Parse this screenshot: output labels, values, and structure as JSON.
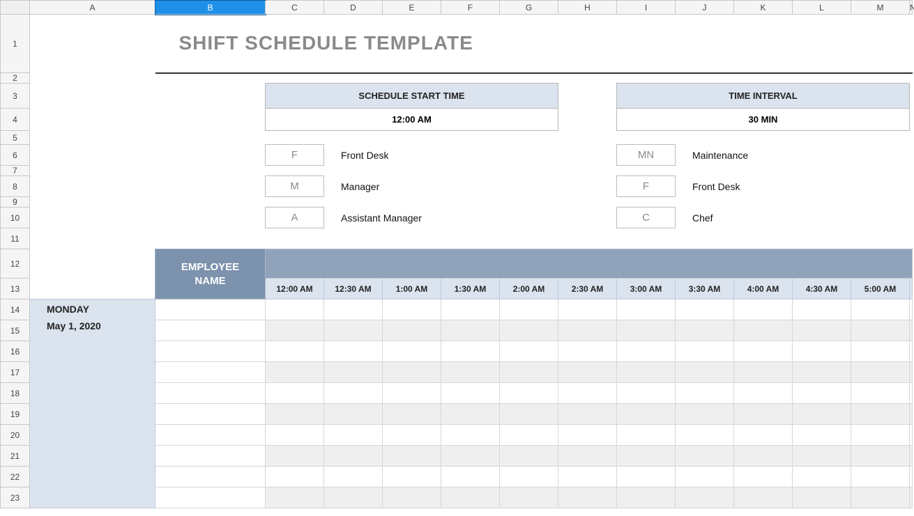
{
  "columns": [
    "A",
    "B",
    "C",
    "D",
    "E",
    "F",
    "G",
    "H",
    "I",
    "J",
    "K",
    "L",
    "M",
    "N"
  ],
  "rows": [
    "1",
    "2",
    "3",
    "4",
    "5",
    "6",
    "7",
    "8",
    "9",
    "10",
    "11",
    "12",
    "13",
    "14",
    "15",
    "16",
    "17",
    "18",
    "19",
    "20",
    "21",
    "22",
    "23"
  ],
  "selected_column": "B",
  "title": "SHIFT SCHEDULE TEMPLATE",
  "boxes": {
    "start_time": {
      "label": "SCHEDULE START TIME",
      "value": "12:00 AM"
    },
    "interval": {
      "label": "TIME INTERVAL",
      "value": "30 MIN"
    }
  },
  "legend": {
    "left": [
      {
        "code": "F",
        "label": "Front Desk"
      },
      {
        "code": "M",
        "label": "Manager"
      },
      {
        "code": "A",
        "label": "Assistant Manager"
      }
    ],
    "right": [
      {
        "code": "MN",
        "label": "Maintenance"
      },
      {
        "code": "F",
        "label": "Front Desk"
      },
      {
        "code": "C",
        "label": "Chef"
      }
    ]
  },
  "schedule": {
    "employee_header": "EMPLOYEE NAME",
    "times": [
      "12:00 AM",
      "12:30 AM",
      "1:00 AM",
      "1:30 AM",
      "2:00 AM",
      "2:30 AM",
      "3:00 AM",
      "3:30 AM",
      "4:00 AM",
      "4:30 AM",
      "5:00 AM"
    ],
    "day": {
      "name": "MONDAY",
      "date": "May 1, 2020"
    }
  }
}
